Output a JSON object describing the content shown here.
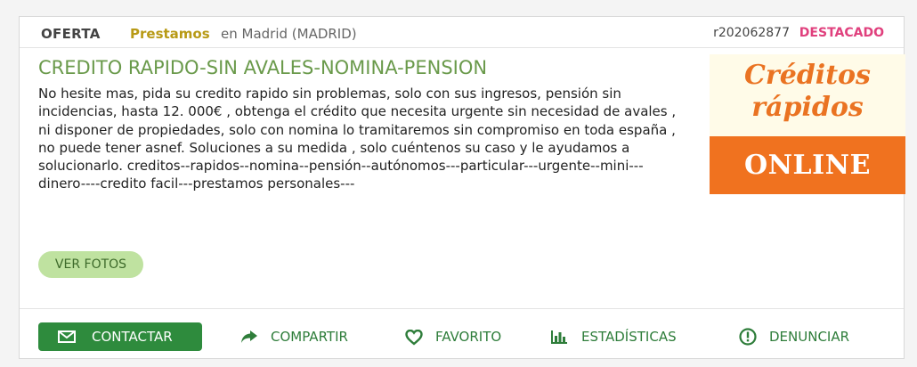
{
  "header": {
    "offer_type": "OFERTA",
    "category": "Prestamos",
    "location": "en Madrid (MADRID)",
    "reference": "r202062877",
    "featured": "DESTACADO"
  },
  "listing": {
    "title": "CREDITO RAPIDO-SIN AVALES-NOMINA-PENSION",
    "description": "No hesite mas, pida su credito rapido sin problemas, solo con sus ingresos, pensión sin incidencias, hasta 12. 000€ , obtenga el crédito que necesita urgente sin necesidad de avales , ni disponer de propiedades, solo con nomina lo tramitaremos sin compromiso en toda españa , no puede tener asnef. Soluciones a su medida , solo cuéntenos su caso y le ayudamos a solucionarlo. creditos--rapidos--nomina--pensión--autónomos---particular---urgente--mini---dinero----credito facil---prestamos personales---",
    "photos_button": "VER FOTOS"
  },
  "promo_image": {
    "line1": "Créditos",
    "line2": "rápidos",
    "line3": "ONLINE"
  },
  "actions": {
    "contact": {
      "label": "CONTACTAR",
      "icon": "envelope-icon"
    },
    "share": {
      "label": "COMPARTIR",
      "icon": "share-arrow-icon"
    },
    "favorite": {
      "label": "FAVORITO",
      "icon": "heart-icon"
    },
    "stats": {
      "label": "ESTADÍSTICAS",
      "icon": "bar-chart-icon"
    },
    "report": {
      "label": "DENUNCIAR",
      "icon": "alert-circle-icon"
    }
  },
  "colors": {
    "title_green": "#6a9a4b",
    "category_gold": "#b89a16",
    "featured_pink": "#e0407d",
    "action_green": "#2e7d3a",
    "contact_button": "#2e8b3d",
    "promo_orange": "#f0721f"
  }
}
